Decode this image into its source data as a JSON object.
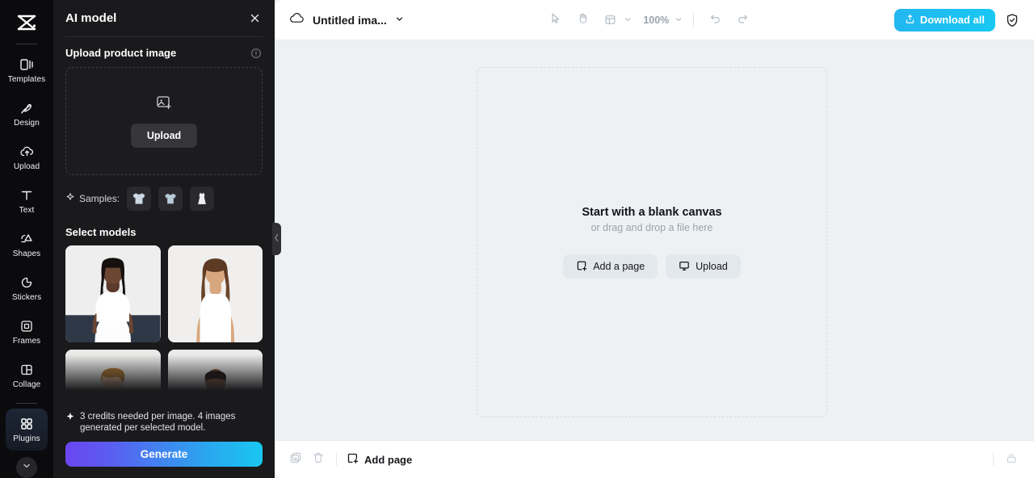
{
  "rail": {
    "logo_icon": "capcut-logo-icon",
    "items": [
      {
        "label": "Templates",
        "icon": "templates-icon",
        "active": false
      },
      {
        "label": "Design",
        "icon": "design-icon",
        "active": false
      },
      {
        "label": "Upload",
        "icon": "upload-cloud-icon",
        "active": false
      },
      {
        "label": "Text",
        "icon": "text-icon",
        "active": false
      },
      {
        "label": "Shapes",
        "icon": "shapes-icon",
        "active": false
      },
      {
        "label": "Stickers",
        "icon": "stickers-icon",
        "active": false
      },
      {
        "label": "Frames",
        "icon": "frames-icon",
        "active": false
      },
      {
        "label": "Collage",
        "icon": "collage-icon",
        "active": false
      },
      {
        "label": "Plugins",
        "icon": "plugins-icon",
        "active": true
      }
    ],
    "expand_icon": "chevron-down-icon"
  },
  "panel": {
    "title": "AI model",
    "close_icon": "close-icon",
    "upload_section": {
      "title": "Upload product image",
      "info_icon": "info-icon",
      "dropzone_icon": "add-image-icon",
      "upload_label": "Upload"
    },
    "samples": {
      "label": "Samples:",
      "sparkle_icon": "sparkle-icon",
      "items": [
        {
          "name": "sample-shirt",
          "garment": "long-sleeve-shirt"
        },
        {
          "name": "sample-tshirt",
          "garment": "t-shirt"
        },
        {
          "name": "sample-dress",
          "garment": "dress"
        }
      ]
    },
    "models": {
      "title": "Select models",
      "cards": [
        {
          "name": "model-card-1",
          "selected": true,
          "desc": "woman in white top"
        },
        {
          "name": "model-card-2",
          "selected": false,
          "desc": "woman in white tank top"
        },
        {
          "name": "model-card-3",
          "selected": false,
          "desc": "man in black tee"
        },
        {
          "name": "model-card-4",
          "selected": false,
          "desc": "man in white tee"
        }
      ]
    },
    "credits_icon": "sparkle-icon",
    "credits_text": "3 credits needed per image. 4 images generated per selected model.",
    "generate_label": "Generate",
    "collapse_icon": "chevron-left-icon"
  },
  "topbar": {
    "cloud_icon": "cloud-icon",
    "doc_title": "Untitled ima...",
    "doc_chevron_icon": "chevron-down-icon",
    "tools": [
      {
        "name": "select-tool",
        "icon": "cursor-icon"
      },
      {
        "name": "hand-tool",
        "icon": "hand-icon"
      },
      {
        "name": "layout-tool",
        "icon": "layout-icon"
      }
    ],
    "layout_chevron_icon": "chevron-down-icon",
    "zoom_level": "100%",
    "zoom_chevron_icon": "chevron-down-icon",
    "undo_icon": "undo-icon",
    "redo_icon": "redo-icon",
    "download_label": "Download all",
    "download_icon": "export-icon",
    "shield_icon": "shield-check-icon"
  },
  "canvas": {
    "title": "Start with a blank canvas",
    "subtitle": "or drag and drop a file here",
    "add_page_label": "Add a page",
    "add_page_icon": "add-page-icon",
    "upload_label": "Upload",
    "upload_icon": "monitor-upload-icon"
  },
  "statusbar": {
    "duplicate_icon": "duplicate-page-icon",
    "delete_icon": "trash-icon",
    "add_page_label": "Add page",
    "add_page_icon": "add-page-icon",
    "lock_icon": "unlock-icon"
  },
  "colors": {
    "accent_cyan": "#1ec2f1",
    "panel_bg": "#1a1a1c",
    "rail_bg": "#0b0b0d",
    "canvas_bg": "#eef1f4",
    "generate_from": "#6b46f0",
    "generate_to": "#19c6f0"
  }
}
